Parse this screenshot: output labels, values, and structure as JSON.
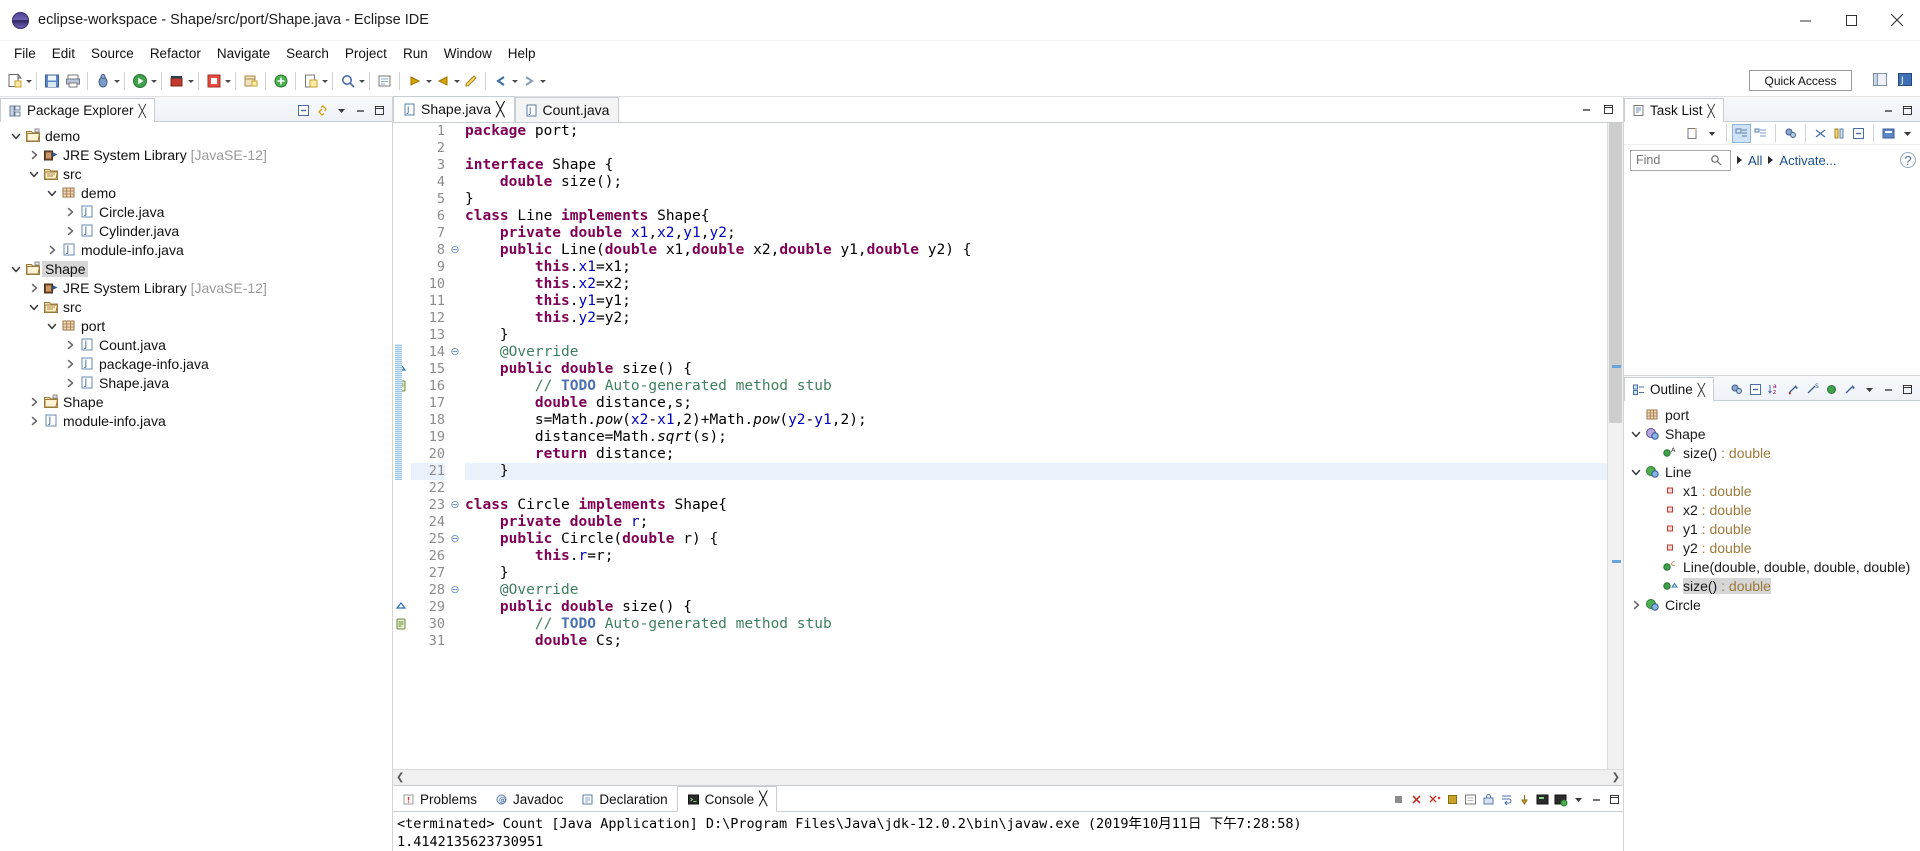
{
  "window": {
    "title": "eclipse-workspace - Shape/src/port/Shape.java - Eclipse IDE",
    "app_icon": "eclipse-icon",
    "controls": {
      "minimize": "minimize-button",
      "maximize": "maximize-button",
      "close": "close-button"
    }
  },
  "menubar": [
    "File",
    "Edit",
    "Source",
    "Refactor",
    "Navigate",
    "Search",
    "Project",
    "Run",
    "Window",
    "Help"
  ],
  "toolbar": {
    "quick_access": "Quick Access",
    "groups": [
      [
        "new-wizard-icon",
        "save-icon",
        "print-icon"
      ],
      [
        "debug-icon",
        "run-icon",
        "run-external-icon",
        "profile-icon"
      ],
      [
        "new-java-project-icon",
        "new-package-icon",
        "new-class-icon"
      ],
      [
        "search-icon",
        "open-type-icon"
      ],
      [
        "next-annotation-icon",
        "previous-annotation-icon",
        "last-edit-icon",
        "back-icon",
        "forward-icon"
      ]
    ]
  },
  "explorer": {
    "title": "Package Explorer",
    "close_glyph": "╳",
    "tools": [
      "collapse-all-icon",
      "link-with-editor-icon",
      "view-menu-icon",
      "minimize-icon",
      "maximize-icon"
    ],
    "tree": [
      {
        "label": "demo",
        "icon": "project-icon",
        "indent": 0,
        "twisty": "open",
        "type": "project"
      },
      {
        "label": "JRE System Library",
        "suffix": "[JavaSE-12]",
        "icon": "library-icon",
        "indent": 1,
        "twisty": "closed",
        "type": "library"
      },
      {
        "label": "src",
        "icon": "source-folder-icon",
        "indent": 1,
        "twisty": "open",
        "type": "srcfolder"
      },
      {
        "label": "demo",
        "icon": "package-icon",
        "indent": 2,
        "twisty": "open",
        "type": "package"
      },
      {
        "label": "Circle.java",
        "icon": "java-file-icon",
        "indent": 3,
        "twisty": "closed",
        "type": "file"
      },
      {
        "label": "Cylinder.java",
        "icon": "java-file-icon",
        "indent": 3,
        "twisty": "closed",
        "type": "file"
      },
      {
        "label": "module-info.java",
        "icon": "java-file-icon",
        "indent": 2,
        "twisty": "closed",
        "type": "file"
      },
      {
        "label": "Shape",
        "icon": "project-icon",
        "indent": 0,
        "twisty": "open",
        "type": "project",
        "selected": true
      },
      {
        "label": "JRE System Library",
        "suffix": "[JavaSE-12]",
        "icon": "library-icon",
        "indent": 1,
        "twisty": "closed",
        "type": "library"
      },
      {
        "label": "src",
        "icon": "source-folder-icon",
        "indent": 1,
        "twisty": "open",
        "type": "srcfolder"
      },
      {
        "label": "port",
        "icon": "package-icon",
        "indent": 2,
        "twisty": "open",
        "type": "package"
      },
      {
        "label": "Count.java",
        "icon": "java-file-icon",
        "indent": 3,
        "twisty": "closed",
        "type": "file"
      },
      {
        "label": "package-info.java",
        "icon": "java-file-icon",
        "indent": 3,
        "twisty": "closed",
        "type": "file"
      },
      {
        "label": "Shape.java",
        "icon": "java-file-icon",
        "indent": 3,
        "twisty": "closed",
        "type": "file"
      },
      {
        "label": "Shape",
        "icon": "folder-icon",
        "indent": 1,
        "twisty": "closed",
        "type": "folder"
      },
      {
        "label": "module-info.java",
        "icon": "java-file-icon",
        "indent": 1,
        "twisty": "closed",
        "type": "file"
      }
    ]
  },
  "editor": {
    "tabs": [
      {
        "label": "Shape.java",
        "active": true,
        "icon": "java-file-icon",
        "close_glyph": "╳"
      },
      {
        "label": "Count.java",
        "active": false,
        "icon": "java-file-icon"
      }
    ],
    "minimize_icon": "minimize-icon",
    "maximize_icon": "maximize-icon",
    "first_line": 1,
    "highlighted_line": 21,
    "lines": [
      {
        "n": 1,
        "fold": "",
        "mark": "",
        "html": "<span class='kw'>package</span> port;"
      },
      {
        "n": 2,
        "fold": "",
        "mark": "",
        "html": ""
      },
      {
        "n": 3,
        "fold": "",
        "mark": "",
        "html": "<span class='kw'>interface</span> Shape {"
      },
      {
        "n": 4,
        "fold": "",
        "mark": "",
        "html": "    <span class='kw'>double</span> size();"
      },
      {
        "n": 5,
        "fold": "",
        "mark": "",
        "html": "}"
      },
      {
        "n": 6,
        "fold": "",
        "mark": "",
        "html": "<span class='kw'>class</span> Line <span class='kw'>implements</span> Shape{"
      },
      {
        "n": 7,
        "fold": "",
        "mark": "",
        "html": "    <span class='kw'>private double</span> <span class='fld'>x1</span>,<span class='fld'>x2</span>,<span class='fld'>y1</span>,<span class='fld'>y2</span>;"
      },
      {
        "n": 8,
        "fold": "⊖",
        "mark": "",
        "html": "    <span class='kw'>public</span> Line(<span class='kw'>double</span> x1,<span class='kw'>double</span> x2,<span class='kw'>double</span> y1,<span class='kw'>double</span> y2) {"
      },
      {
        "n": 9,
        "fold": "",
        "mark": "",
        "html": "        <span class='kw'>this</span>.<span class='fld'>x1</span>=x1;"
      },
      {
        "n": 10,
        "fold": "",
        "mark": "",
        "html": "        <span class='kw'>this</span>.<span class='fld'>x2</span>=x2;"
      },
      {
        "n": 11,
        "fold": "",
        "mark": "",
        "html": "        <span class='kw'>this</span>.<span class='fld'>y1</span>=y1;"
      },
      {
        "n": 12,
        "fold": "",
        "mark": "",
        "html": "        <span class='kw'>this</span>.<span class='fld'>y2</span>=y2;"
      },
      {
        "n": 13,
        "fold": "",
        "mark": "",
        "html": "    }"
      },
      {
        "n": 14,
        "fold": "⊖",
        "mark": "",
        "html": "    <span class='cm'>@Override</span>"
      },
      {
        "n": 15,
        "fold": "",
        "mark": "override",
        "html": "    <span class='kw'>public double</span> size() {"
      },
      {
        "n": 16,
        "fold": "",
        "mark": "todo",
        "html": "        <span class='cm'>// </span><span class='todo'>TODO</span><span class='cm'> Auto-generated method stub</span>"
      },
      {
        "n": 17,
        "fold": "",
        "mark": "",
        "html": "        <span class='kw'>double</span> distance,s;"
      },
      {
        "n": 18,
        "fold": "",
        "mark": "",
        "html": "        s=Math.<span class='mth'>pow</span>(<span class='fld'>x2</span>-<span class='fld'>x1</span>,2)+Math.<span class='mth'>pow</span>(<span class='fld'>y2</span>-<span class='fld'>y1</span>,2);"
      },
      {
        "n": 19,
        "fold": "",
        "mark": "",
        "html": "        distance=Math.<span class='mth'>sqrt</span>(s);"
      },
      {
        "n": 20,
        "fold": "",
        "mark": "",
        "html": "        <span class='kw'>return</span> distance;"
      },
      {
        "n": 21,
        "fold": "",
        "mark": "",
        "html": "    }"
      },
      {
        "n": 22,
        "fold": "",
        "mark": "",
        "html": ""
      },
      {
        "n": 23,
        "fold": "⊖",
        "mark": "",
        "html": "<span class='kw'>class</span> Circle <span class='kw'>implements</span> Shape{"
      },
      {
        "n": 24,
        "fold": "",
        "mark": "",
        "html": "    <span class='kw'>private double</span> <span class='fld'>r</span>;"
      },
      {
        "n": 25,
        "fold": "⊖",
        "mark": "",
        "html": "    <span class='kw'>public</span> Circle(<span class='kw'>double</span> r) {"
      },
      {
        "n": 26,
        "fold": "",
        "mark": "",
        "html": "        <span class='kw'>this</span>.<span class='fld'>r</span>=r;"
      },
      {
        "n": 27,
        "fold": "",
        "mark": "",
        "html": "    }"
      },
      {
        "n": 28,
        "fold": "⊖",
        "mark": "",
        "html": "    <span class='cm'>@Override</span>"
      },
      {
        "n": 29,
        "fold": "",
        "mark": "override",
        "html": "    <span class='kw'>public double</span> size() {"
      },
      {
        "n": 30,
        "fold": "",
        "mark": "todo",
        "html": "        <span class='cm'>// </span><span class='todo'>TODO</span><span class='cm'> Auto-generated method stub</span>"
      },
      {
        "n": 31,
        "fold": "",
        "mark": "",
        "html": "        <span class='kw'>double</span> Cs;"
      }
    ]
  },
  "console": {
    "tabs": [
      {
        "label": "Problems",
        "icon": "problems-icon",
        "active": false
      },
      {
        "label": "Javadoc",
        "icon": "javadoc-icon",
        "active": false
      },
      {
        "label": "Declaration",
        "icon": "declaration-icon",
        "active": false
      },
      {
        "label": "Console",
        "icon": "console-icon",
        "active": true,
        "close_glyph": "╳"
      }
    ],
    "tools": [
      "terminate-icon",
      "remove-launch-icon",
      "remove-all-icon",
      "stop-icon",
      "clear-console-icon",
      "scroll-lock-icon",
      "word-wrap-icon",
      "pin-console-icon",
      "display-selected-console-icon",
      "open-console-icon",
      "view-menu-icon",
      "minimize-icon",
      "maximize-icon"
    ],
    "status_line": "<terminated> Count [Java Application] D:\\Program Files\\Java\\jdk-12.0.2\\bin\\javaw.exe (2019年10月11日 下午7:28:58)",
    "output": "1.4142135623730951"
  },
  "tasklist": {
    "title": "Task List",
    "close_glyph": "╳",
    "tools": [
      "new-task-icon",
      "categorize-icon",
      "schedule-icon",
      "focus-icon",
      "synchronize-icon",
      "collapse-all-icon",
      "presentation-icon",
      "view-menu-icon"
    ],
    "find_placeholder": "Find",
    "find_value": "",
    "filter_all": "All",
    "filter_activate": "Activate...",
    "help_glyph": "?"
  },
  "outline": {
    "title": "Outline",
    "close_glyph": "╳",
    "tools": [
      "focus-icon",
      "collapse-all-icon",
      "sort-icon",
      "hide-fields-icon",
      "hide-static-icon",
      "hide-nonpublic-icon",
      "hide-local-types-icon",
      "view-menu-icon",
      "minimize-icon",
      "maximize-icon"
    ],
    "items": [
      {
        "label": "port",
        "indent": 0,
        "twisty": "none",
        "icon": "package-icon",
        "type": ""
      },
      {
        "label": "Shape",
        "indent": 0,
        "twisty": "open",
        "icon": "interface-icon",
        "type": ""
      },
      {
        "label": "size()",
        "type": " : double",
        "indent": 1,
        "twisty": "none",
        "icon": "public-method-abstract-icon"
      },
      {
        "label": "Line",
        "indent": 0,
        "twisty": "open",
        "icon": "class-icon",
        "type": ""
      },
      {
        "label": "x1",
        "type": " : double",
        "indent": 1,
        "twisty": "none",
        "icon": "private-field-icon"
      },
      {
        "label": "x2",
        "type": " : double",
        "indent": 1,
        "twisty": "none",
        "icon": "private-field-icon"
      },
      {
        "label": "y1",
        "type": " : double",
        "indent": 1,
        "twisty": "none",
        "icon": "private-field-icon"
      },
      {
        "label": "y2",
        "type": " : double",
        "indent": 1,
        "twisty": "none",
        "icon": "private-field-icon"
      },
      {
        "label": "Line(double, double, double, double)",
        "type": "",
        "indent": 1,
        "twisty": "none",
        "icon": "public-constructor-icon"
      },
      {
        "label": "size()",
        "type": " : double",
        "indent": 1,
        "twisty": "none",
        "icon": "public-method-override-icon",
        "selected": true
      },
      {
        "label": "Circle",
        "indent": 0,
        "twisty": "closed",
        "icon": "class-icon",
        "type": ""
      }
    ]
  },
  "colors": {
    "keyword": "#7f0055",
    "comment": "#3f7f5f",
    "field": "#0000c0",
    "todo": "#4a6fb5",
    "selection": "#d6d6d6",
    "current_line": "#eaf1fb",
    "link": "#1a4f8f"
  }
}
